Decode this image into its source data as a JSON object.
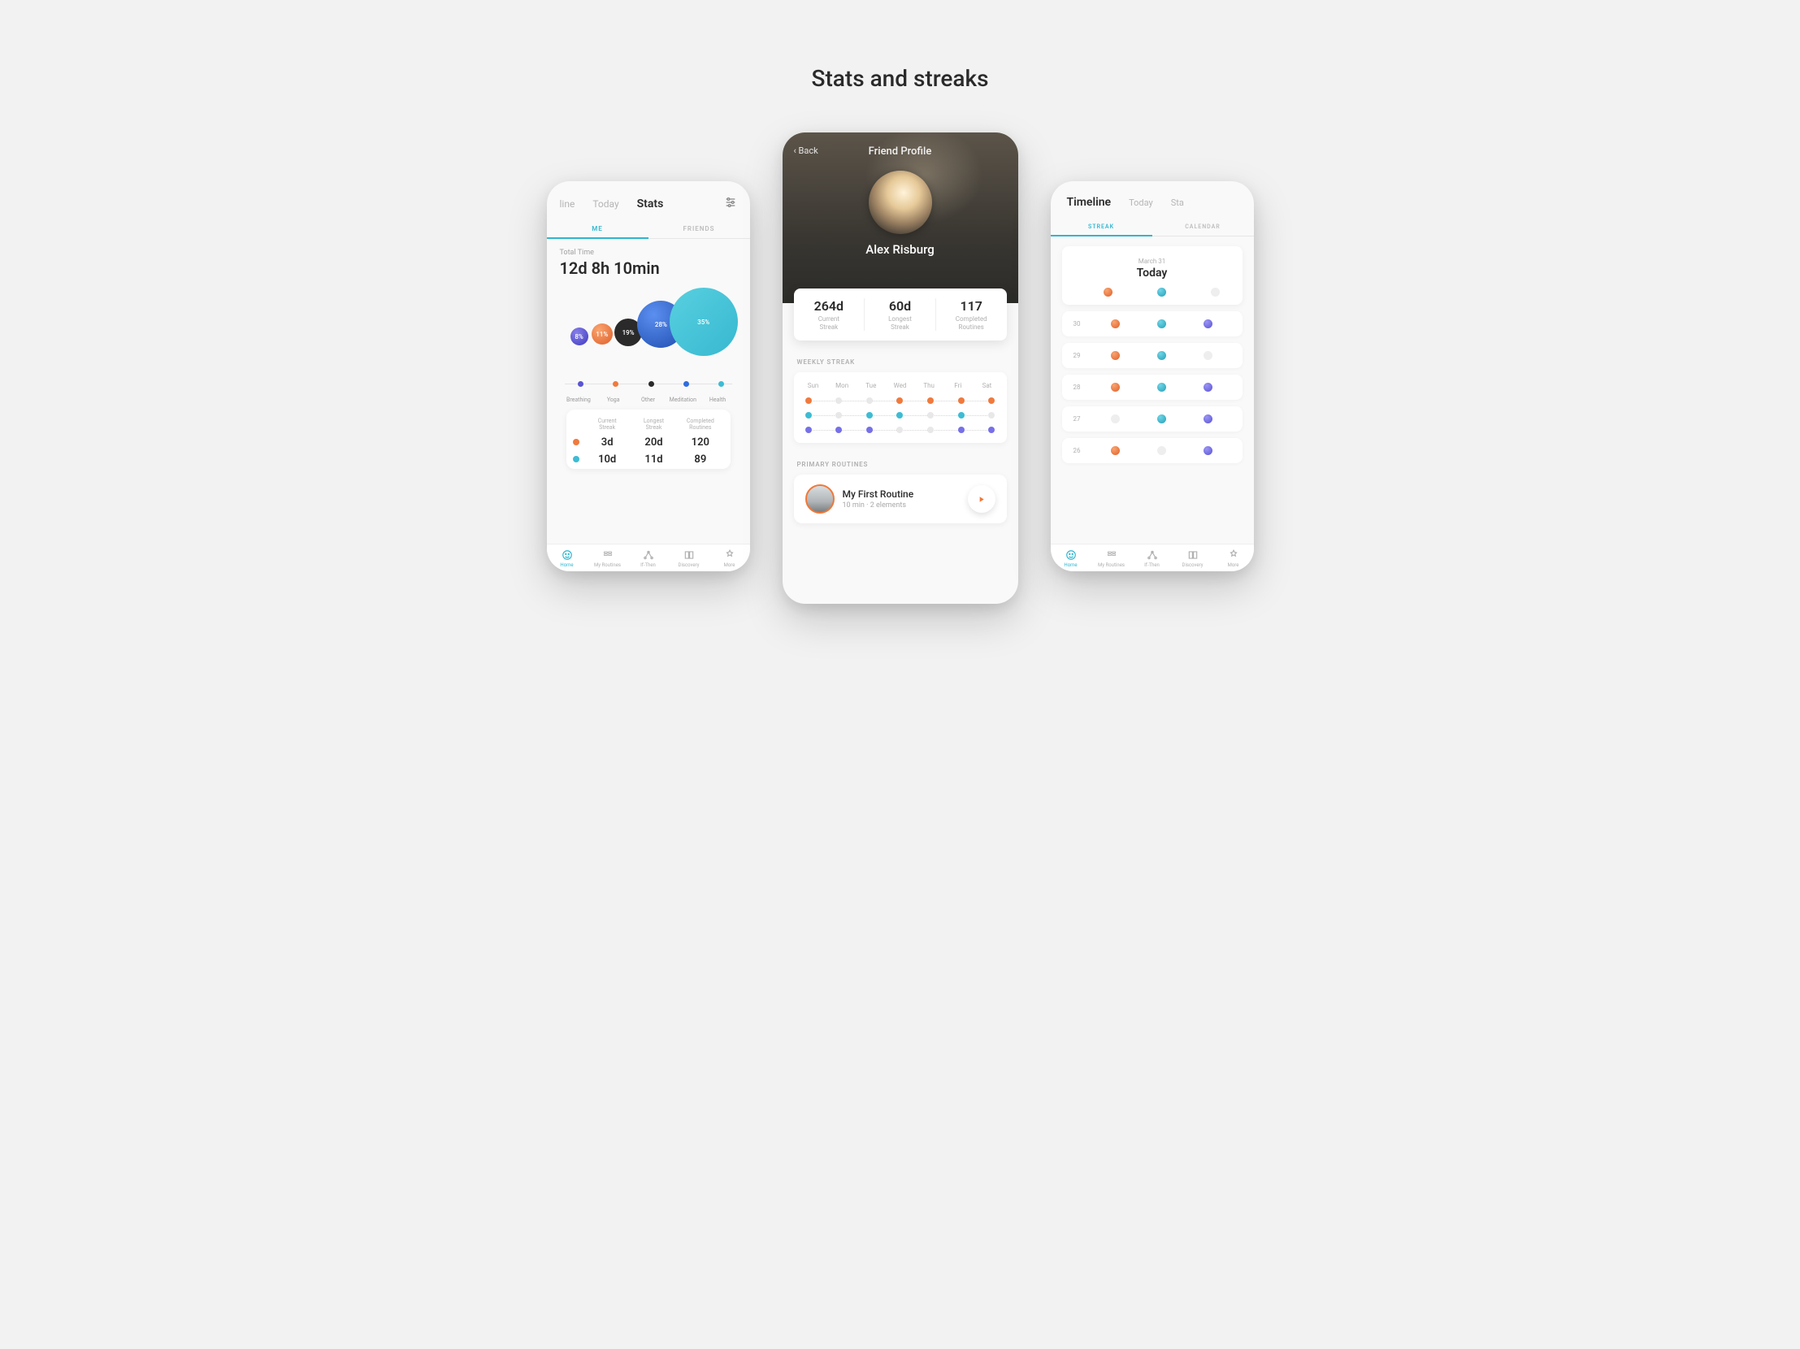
{
  "page": {
    "title": "Stats and streaks"
  },
  "colors": {
    "accent": "#2fb6d0",
    "orange": "#f07a3e",
    "black": "#2a2a2a",
    "blue": "#2f6de0",
    "teal": "#3dbcd4",
    "purple": "#7670e8",
    "violet": "#5a53d4"
  },
  "nav": {
    "items": [
      {
        "label": "Home",
        "active": true,
        "icon": "home-icon"
      },
      {
        "label": "My Routines",
        "active": false,
        "icon": "routines-icon"
      },
      {
        "label": "If-Then",
        "active": false,
        "icon": "ifthen-icon"
      },
      {
        "label": "Discovery",
        "active": false,
        "icon": "discovery-icon"
      },
      {
        "label": "More",
        "active": false,
        "icon": "more-icon"
      }
    ]
  },
  "stats": {
    "tabs": {
      "left": "line",
      "mid": "Today",
      "right": "Stats",
      "active": "Stats"
    },
    "subtabs": {
      "me": "ME",
      "friends": "FRIENDS",
      "active": "ME"
    },
    "total_time": {
      "label": "Total Time",
      "value": "12d 8h 10min"
    },
    "bubbles": [
      {
        "label": "8%",
        "color": "violet",
        "size": 22,
        "x": 6,
        "y": 55
      },
      {
        "label": "11%",
        "color": "orange",
        "size": 26,
        "x": 18,
        "y": 50
      },
      {
        "label": "19%",
        "color": "black",
        "size": 34,
        "x": 31,
        "y": 44
      },
      {
        "label": "28%",
        "color": "blue",
        "size": 58,
        "x": 44,
        "y": 22
      },
      {
        "label": "35%",
        "color": "health",
        "size": 84,
        "x": 62,
        "y": 6
      }
    ],
    "legend": [
      {
        "label": "Breathing",
        "color": "violet"
      },
      {
        "label": "Yoga",
        "color": "orange"
      },
      {
        "label": "Other",
        "color": "black"
      },
      {
        "label": "Meditation",
        "color": "blue"
      },
      {
        "label": "Health",
        "color": "teal"
      }
    ],
    "streak_card": {
      "headers": {
        "current": "Current\nStreak",
        "longest": "Longest\nStreak",
        "completed": "Completed\nRoutines"
      },
      "rows": [
        {
          "color": "orange",
          "current": "3d",
          "longest": "20d",
          "completed": "120"
        },
        {
          "color": "teal",
          "current": "10d",
          "longest": "11d",
          "completed": "89"
        }
      ]
    }
  },
  "chart_data": {
    "type": "bubble",
    "title": "Total Time",
    "subtitle": "12d 8h 10min",
    "series": [
      {
        "name": "Breathing",
        "value": 8,
        "unit": "%",
        "color": "#5a53d4"
      },
      {
        "name": "Yoga",
        "value": 11,
        "unit": "%",
        "color": "#f07a3e"
      },
      {
        "name": "Other",
        "value": 19,
        "unit": "%",
        "color": "#2a2a2a"
      },
      {
        "name": "Meditation",
        "value": 28,
        "unit": "%",
        "color": "#2f6de0"
      },
      {
        "name": "Health",
        "value": 35,
        "unit": "%",
        "color": "#3dbcd4"
      }
    ]
  },
  "friend": {
    "back": "Back",
    "header_title": "Friend Profile",
    "name": "Alex Risburg",
    "stats": [
      {
        "value": "264d",
        "label": "Current\nStreak"
      },
      {
        "value": "60d",
        "label": "Longest\nStreak"
      },
      {
        "value": "117",
        "label": "Completed\nRoutines"
      }
    ],
    "weekly_label": "WEEKLY STREAK",
    "week_days": [
      "Sun",
      "Mon",
      "Tue",
      "Wed",
      "Thu",
      "Fri",
      "Sat"
    ],
    "week_rows": [
      {
        "color": "orange",
        "dots": [
          true,
          false,
          false,
          true,
          true,
          true,
          true
        ]
      },
      {
        "color": "teal",
        "dots": [
          true,
          false,
          true,
          true,
          false,
          true,
          false
        ]
      },
      {
        "color": "purple",
        "dots": [
          true,
          true,
          true,
          false,
          false,
          true,
          true
        ]
      }
    ],
    "primary_label": "PRIMARY ROUTINES",
    "routine": {
      "title": "My First Routine",
      "subtitle": "10 min  ·  2 elements"
    }
  },
  "timeline": {
    "tabs": {
      "left": "Timeline",
      "mid": "Today",
      "right": "Sta",
      "active": "Timeline"
    },
    "subtabs": {
      "streak": "STREAK",
      "calendar": "CALENDAR",
      "active": "STREAK"
    },
    "date": {
      "label": "March 31",
      "value": "Today"
    },
    "track_colors": [
      "orange",
      "teal",
      "purple"
    ],
    "rows": [
      {
        "day": "",
        "today": true,
        "dots": [
          true,
          true,
          false
        ]
      },
      {
        "day": "30",
        "today": false,
        "dots": [
          true,
          true,
          true
        ]
      },
      {
        "day": "29",
        "today": false,
        "dots": [
          true,
          true,
          false
        ]
      },
      {
        "day": "28",
        "today": false,
        "dots": [
          true,
          true,
          true
        ]
      },
      {
        "day": "27",
        "today": false,
        "dots": [
          false,
          true,
          true
        ]
      },
      {
        "day": "26",
        "today": false,
        "dots": [
          true,
          false,
          true
        ]
      }
    ]
  }
}
